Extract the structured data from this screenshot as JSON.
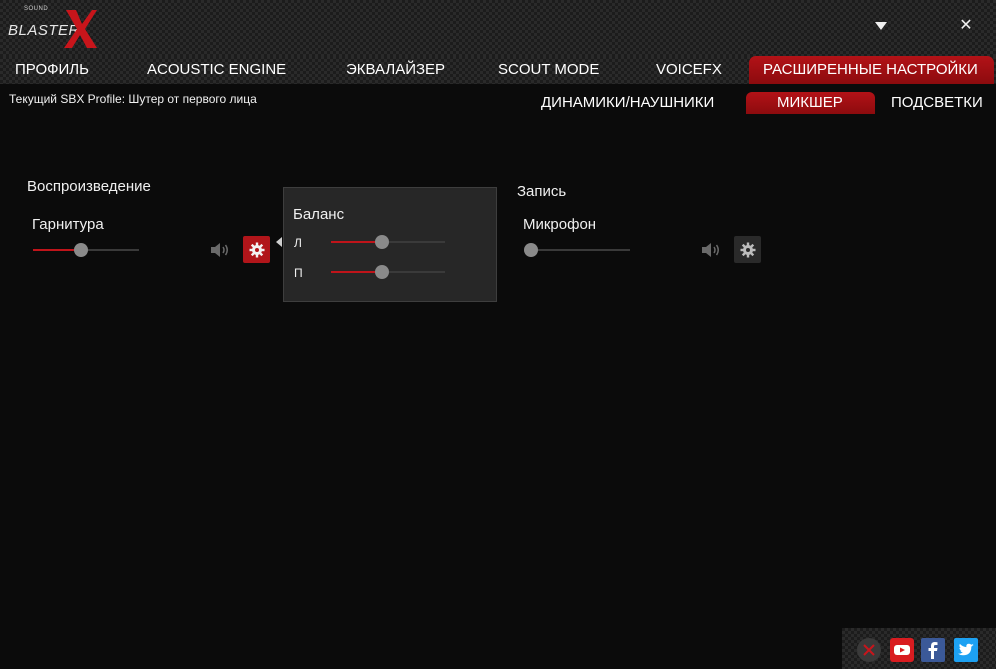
{
  "app": {
    "logo_small": "SOUND",
    "logo_word": "BLASTER",
    "logo_mark": "X",
    "accent_color": "#b1151a"
  },
  "window_controls": {
    "minimize_icon": "triangle-down-icon",
    "close_label": "✕"
  },
  "main_tabs": [
    {
      "label": "ПРОФИЛЬ",
      "active": false
    },
    {
      "label": "ACOUSTIC ENGINE",
      "active": false
    },
    {
      "label": "ЭКВАЛАЙЗЕР",
      "active": false
    },
    {
      "label": "SCOUT MODE",
      "active": false
    },
    {
      "label": "VOICEFX",
      "active": false
    },
    {
      "label": "РАСШИРЕННЫЕ НАСТРОЙКИ",
      "active": true
    }
  ],
  "profile": {
    "text": "Текущий SBX Profile: Шутер от первого лица"
  },
  "sub_tabs": [
    {
      "label": "ДИНАМИКИ/НАУШНИКИ",
      "active": false
    },
    {
      "label": "МИКШЕР",
      "active": true
    },
    {
      "label": "ПОДСВЕТКИ",
      "active": false
    }
  ],
  "playback": {
    "title": "Воспроизведение",
    "device": "Гарнитура",
    "volume": 0.45
  },
  "balance": {
    "title": "Баланс",
    "left_label": "Л",
    "right_label": "П",
    "left_value": 0.45,
    "right_value": 0.45
  },
  "recording": {
    "title": "Запись",
    "device": "Микрофон",
    "volume": 0.0
  },
  "social": [
    "close-circle-icon",
    "youtube-icon",
    "facebook-icon",
    "twitter-icon"
  ]
}
